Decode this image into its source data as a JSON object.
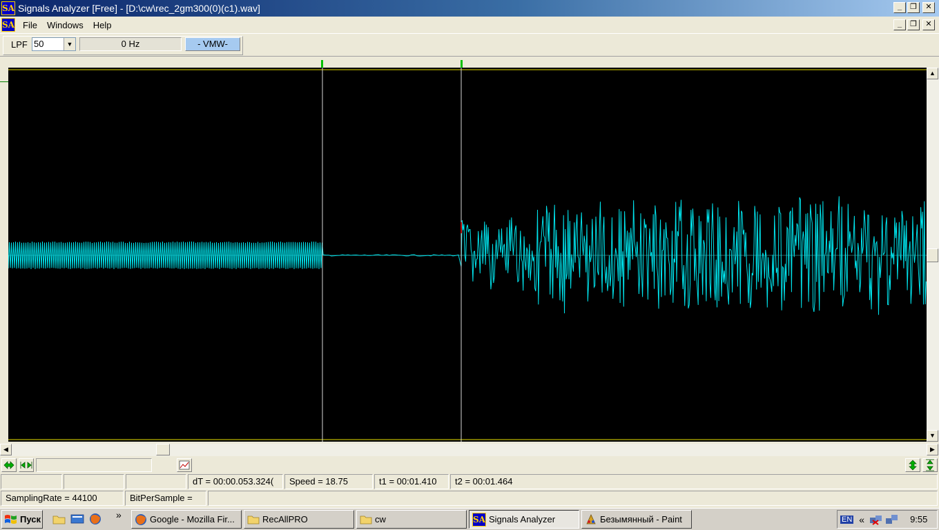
{
  "window": {
    "logo": "SA",
    "title": "Signals Analyzer [Free] - [D:\\cw\\rec_2gm300(0)(c1).wav]",
    "minimize": "_",
    "restore": "❐",
    "close": "✕"
  },
  "menu": [
    "File",
    "Windows",
    "Help"
  ],
  "toolbar": {
    "lpf_label": "LPF",
    "lpf_value": "50",
    "frequency": "0 Hz",
    "mode": "- VMW-"
  },
  "colors": {
    "waveform": "#00e5ee",
    "cursor": "#ffffff",
    "boundary": "#e8e000",
    "marker": "#00c000"
  },
  "status": {
    "row1": [
      "",
      "",
      "",
      "dT = 00:00.053.324(",
      "Speed = 18.75",
      "t1 = 00:01.410",
      "t2 = 00:01.464"
    ],
    "sampling_rate": "SamplingRate = 44100",
    "bits_per_sample": "BitPerSample =",
    "empty": ""
  },
  "taskbar": {
    "start": "Пуск",
    "overflow": "»",
    "tasks": [
      {
        "label": "Google - Mozilla Fir...",
        "icon": "firefox-icon"
      },
      {
        "label": "RecAllPRO",
        "icon": "folder-icon"
      },
      {
        "label": "cw",
        "icon": "folder-icon"
      },
      {
        "label": "Signals Analyzer",
        "icon": "signals-analyzer-icon"
      },
      {
        "label": "Безымянный - Paint",
        "icon": "paint-icon"
      }
    ],
    "tray": {
      "lang": "EN",
      "expand": "«",
      "time": "9:55"
    }
  }
}
